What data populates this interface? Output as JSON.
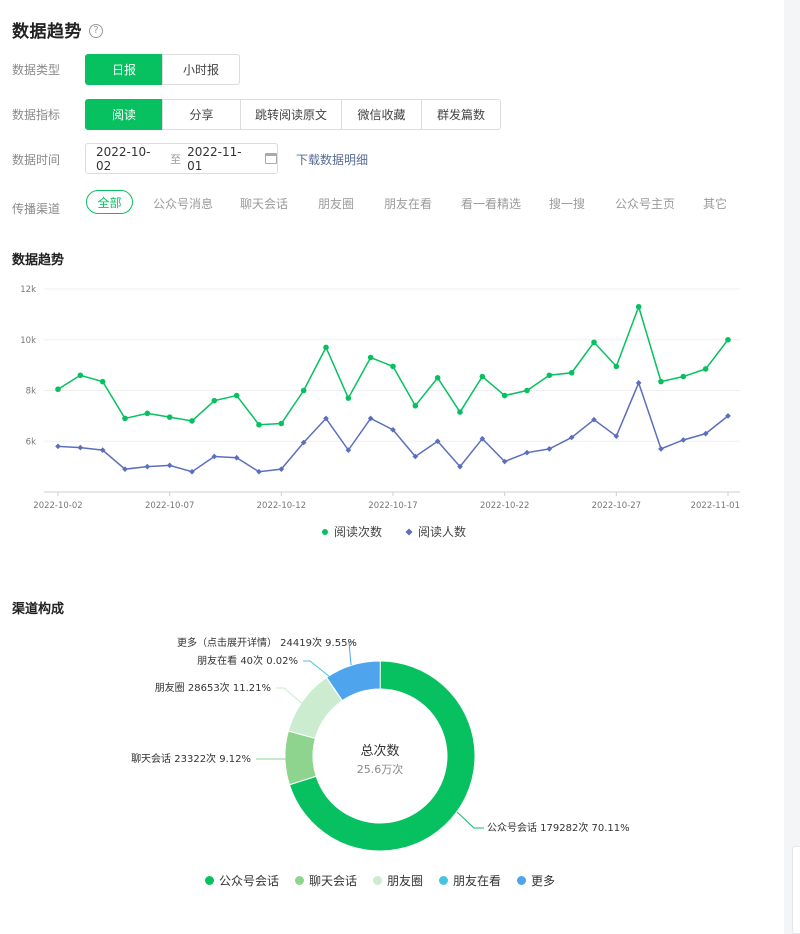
{
  "header": {
    "title": "数据趋势",
    "help": "?"
  },
  "filters": {
    "type_label": "数据类型",
    "type_options": [
      "日报",
      "小时报"
    ],
    "metric_label": "数据指标",
    "metric_options": [
      "阅读",
      "分享",
      "跳转阅读原文",
      "微信收藏",
      "群发篇数"
    ],
    "time_label": "数据时间",
    "date_start": "2022-10-02",
    "date_sep": "至",
    "date_end": "2022-11-01",
    "download": "下载数据明细",
    "channel_label": "传播渠道",
    "channels": [
      "全部",
      "公众号消息",
      "聊天会话",
      "朋友圈",
      "朋友在看",
      "看一看精选",
      "搜一搜",
      "公众号主页",
      "其它"
    ]
  },
  "trend_title": "数据趋势",
  "composition_title": "渠道构成",
  "colors": {
    "accent": "#07c160",
    "series_read_count": "#07c160",
    "series_read_users": "#5b6fbd",
    "pie": [
      "#07c160",
      "#8ed48f",
      "#cbeccf",
      "#44c5dd",
      "#4ea4ed"
    ]
  },
  "chart_data": [
    {
      "type": "line",
      "title": "数据趋势",
      "x": [
        "2022-10-02",
        "2022-10-03",
        "2022-10-04",
        "2022-10-05",
        "2022-10-06",
        "2022-10-07",
        "2022-10-08",
        "2022-10-09",
        "2022-10-10",
        "2022-10-11",
        "2022-10-12",
        "2022-10-13",
        "2022-10-14",
        "2022-10-15",
        "2022-10-16",
        "2022-10-17",
        "2022-10-18",
        "2022-10-19",
        "2022-10-20",
        "2022-10-21",
        "2022-10-22",
        "2022-10-23",
        "2022-10-24",
        "2022-10-25",
        "2022-10-26",
        "2022-10-27",
        "2022-10-28",
        "2022-10-29",
        "2022-10-30",
        "2022-10-31",
        "2022-11-01"
      ],
      "xticks": [
        "2022-10-02",
        "2022-10-07",
        "2022-10-12",
        "2022-10-17",
        "2022-10-22",
        "2022-10-27",
        "2022-11-01"
      ],
      "yticks": [
        "6k",
        "8k",
        "10k",
        "12k"
      ],
      "ylim": [
        4000,
        12000
      ],
      "series": [
        {
          "name": "阅读次数",
          "values": [
            8050,
            8600,
            8350,
            6900,
            7100,
            6950,
            6800,
            7600,
            7800,
            6650,
            6700,
            8000,
            9700,
            7700,
            9300,
            8950,
            7400,
            8500,
            7150,
            8550,
            7800,
            8000,
            8600,
            8700,
            9900,
            8950,
            11300,
            8350,
            8550,
            8850,
            10000
          ]
        },
        {
          "name": "阅读人数",
          "values": [
            5800,
            5750,
            5650,
            4900,
            5000,
            5050,
            4800,
            5400,
            5350,
            4800,
            4900,
            5950,
            6900,
            5650,
            6900,
            6450,
            5400,
            6000,
            5000,
            6100,
            5200,
            5550,
            5700,
            6150,
            6850,
            6200,
            8300,
            5700,
            6050,
            6300,
            7000
          ]
        }
      ],
      "legend": "bottom-center",
      "grid": true
    },
    {
      "type": "pie",
      "title": "渠道构成",
      "center_title": "总次数",
      "center_value": "25.6万次",
      "slices": [
        {
          "name": "公众号会话",
          "value": 179282,
          "percent": "70.11%",
          "label": "公众号会话 179282次 70.11%"
        },
        {
          "name": "聊天会话",
          "value": 23322,
          "percent": "9.12%",
          "label": "聊天会话 23322次 9.12%"
        },
        {
          "name": "朋友圈",
          "value": 28653,
          "percent": "11.21%",
          "label": "朋友圈 28653次 11.21%"
        },
        {
          "name": "朋友在看",
          "value": 40,
          "percent": "0.02%",
          "label": "朋友在看 40次 0.02%"
        },
        {
          "name": "更多",
          "value": 24419,
          "percent": "9.55%",
          "label": "更多（点击展开详情） 24419次 9.55%"
        }
      ],
      "legend": "bottom-center"
    }
  ]
}
